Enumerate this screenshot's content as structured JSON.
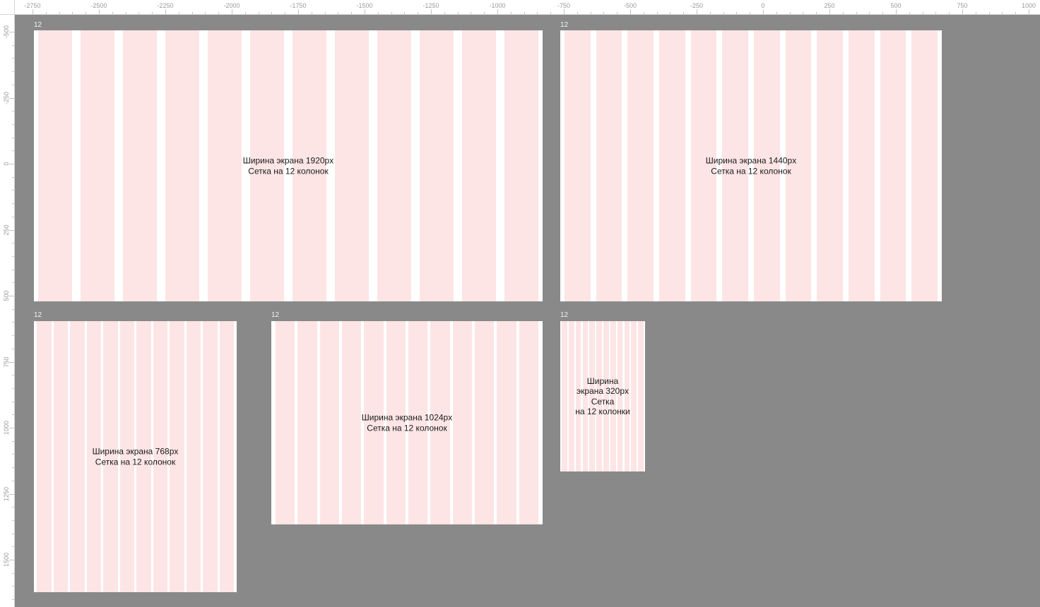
{
  "ruler": {
    "top_labels": [
      "-2750",
      "-2500",
      "-2250",
      "-2000",
      "-1750",
      "-1500",
      "-1250",
      "-1000",
      "-750",
      "-500",
      "-250",
      "0",
      "250",
      "500",
      "750",
      "1000"
    ],
    "left_labels": [
      "-500",
      "-250",
      "0",
      "250",
      "500",
      "750",
      "1000",
      "1250",
      "1500"
    ]
  },
  "frames": [
    {
      "caption": "12",
      "line1": "Ширина экрана 1920px",
      "line2": "Сетка на 12 колонок"
    },
    {
      "caption": "12",
      "line1": "Ширина экрана 1440px",
      "line2": "Сетка на 12 колонок"
    },
    {
      "caption": "12",
      "line1": "Ширина экрана 768px",
      "line2": "Сетка на 12 колонок"
    },
    {
      "caption": "12",
      "line1": "Ширина экрана 1024px",
      "line2": "Сетка на 12 колонок"
    },
    {
      "caption": "12",
      "line1": "Ширина",
      "line2": "экрана 320px",
      "line3": "Сетка",
      "line4": "на 12 колонки"
    }
  ],
  "colors": {
    "canvas": "#898989",
    "frame": "#ffffff",
    "column": "#fde5e5"
  },
  "columns_per_frame": 12
}
